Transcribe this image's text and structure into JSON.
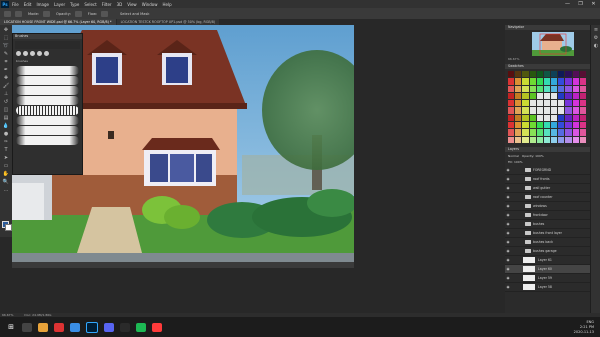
{
  "app": {
    "logo_text": "Ps",
    "menu": [
      "File",
      "Edit",
      "Image",
      "Layer",
      "Type",
      "Select",
      "Filter",
      "3D",
      "View",
      "Window",
      "Help"
    ],
    "window_controls": [
      "—",
      "❐",
      "✕"
    ]
  },
  "options": {
    "mode_label": "Mode:",
    "opacity_label": "Opacity:",
    "flow_label": "Flow:",
    "preset_label": "Select and Mask"
  },
  "tabs": [
    {
      "label": "LOCATION HOUSE FRONT WIDE.psd @ 66.7% (Layer 60, RGB/8) *",
      "active": true
    },
    {
      "label": "LOCATION TESTCK ROOFTOP UP1.psd @ 50% (bg, RGB/8)",
      "active": false
    }
  ],
  "brush_panel": {
    "title": "Brushes",
    "group_label": "brushes"
  },
  "status": {
    "zoom": "66.67%",
    "doc": "Doc: 24.9M/1.86G"
  },
  "right": {
    "navigator_title": "Navigator",
    "navigator_zoom": "66.67%",
    "swatches_title": "Swatches",
    "layers_title": "Layers",
    "blend_mode": "Normal",
    "opacity": "Opacity: 100%",
    "fill": "Fill: 100%",
    "layers": [
      {
        "name": "FOREGRND",
        "type": "folder"
      },
      {
        "name": "roof fronts",
        "type": "folder"
      },
      {
        "name": "wall gutter",
        "type": "folder"
      },
      {
        "name": "roof counter",
        "type": "folder"
      },
      {
        "name": "windows",
        "type": "folder"
      },
      {
        "name": "frontdoor",
        "type": "folder"
      },
      {
        "name": "bushes",
        "type": "folder"
      },
      {
        "name": "bushes front layer",
        "type": "folder"
      },
      {
        "name": "bushes back",
        "type": "folder"
      },
      {
        "name": "bushes garage",
        "type": "folder"
      },
      {
        "name": "Layer 61",
        "type": "layer"
      },
      {
        "name": "Layer 60",
        "type": "layer",
        "selected": true
      },
      {
        "name": "Layer 59",
        "type": "layer"
      },
      {
        "name": "Layer 58",
        "type": "layer"
      }
    ]
  },
  "taskbar": {
    "time": "2:21 PM",
    "date": "2020-11-13",
    "language": "ENG"
  },
  "colors": {
    "sky": "#6aa7d4",
    "roof": "#7a3324",
    "wall": "#e8b08e",
    "grass": "#4f9a3a",
    "accent": "#31a8ff"
  }
}
